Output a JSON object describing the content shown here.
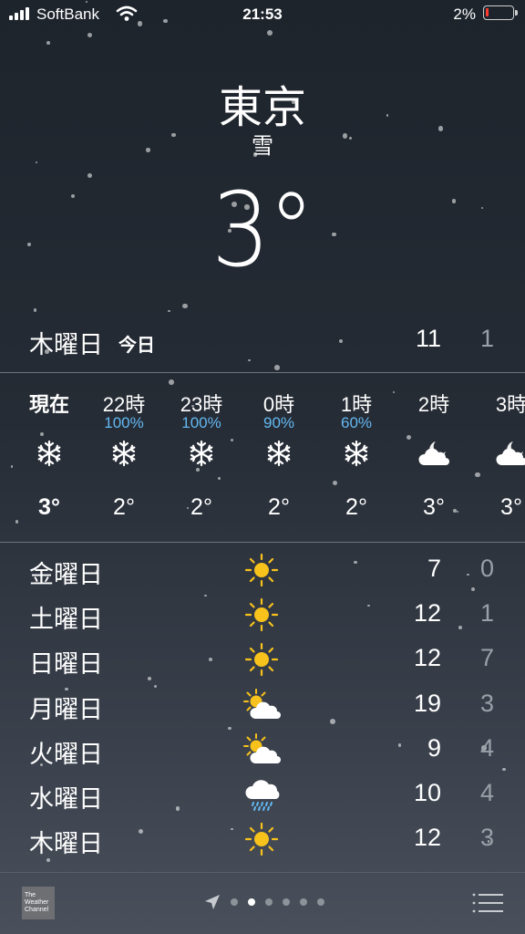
{
  "status_bar": {
    "carrier": "SoftBank",
    "time": "21:53",
    "battery_percent": "2%",
    "battery_level": 0.02,
    "icons": [
      "signal-icon",
      "wifi-icon",
      "battery-icon"
    ]
  },
  "location": {
    "city": "東京",
    "condition": "雪",
    "temperature": "3°"
  },
  "today": {
    "day": "木曜日",
    "label": "今日",
    "high": "11",
    "low": "1"
  },
  "hourly": [
    {
      "time": "現在",
      "pop": "",
      "icon": "snowflake-icon",
      "temp": "3°",
      "bold": true
    },
    {
      "time": "22時",
      "pop": "100%",
      "icon": "snowflake-icon",
      "temp": "2°"
    },
    {
      "time": "23時",
      "pop": "100%",
      "icon": "snowflake-icon",
      "temp": "2°"
    },
    {
      "time": "0時",
      "pop": "90%",
      "icon": "snowflake-icon",
      "temp": "2°"
    },
    {
      "time": "1時",
      "pop": "60%",
      "icon": "snowflake-icon",
      "temp": "2°"
    },
    {
      "time": "2時",
      "pop": "",
      "icon": "moon-cloud-icon",
      "temp": "3°"
    },
    {
      "time": "3時",
      "pop": "",
      "icon": "moon-cloud-icon",
      "temp": "3°"
    }
  ],
  "daily": [
    {
      "day": "金曜日",
      "icon": "sun-icon",
      "high": "7",
      "low": "0"
    },
    {
      "day": "土曜日",
      "icon": "sun-icon",
      "high": "12",
      "low": "1"
    },
    {
      "day": "日曜日",
      "icon": "sun-icon",
      "high": "12",
      "low": "7"
    },
    {
      "day": "月曜日",
      "icon": "sun-cloud-icon",
      "high": "19",
      "low": "3"
    },
    {
      "day": "火曜日",
      "icon": "sun-cloud-icon",
      "high": "9",
      "low": "4"
    },
    {
      "day": "水曜日",
      "icon": "rain-cloud-icon",
      "high": "10",
      "low": "4"
    },
    {
      "day": "木曜日",
      "icon": "sun-icon",
      "high": "12",
      "low": "3"
    }
  ],
  "toolbar": {
    "logo_text": "The Weather Channel",
    "page_dots": 6,
    "active_page": 1,
    "icons": [
      "location-arrow-icon",
      "list-icon"
    ]
  },
  "colors": {
    "precipitation": "#62b8f2",
    "sun": "#f7c21c",
    "low_temp": "#9aa0a8",
    "battery_low": "#ff3b30"
  }
}
